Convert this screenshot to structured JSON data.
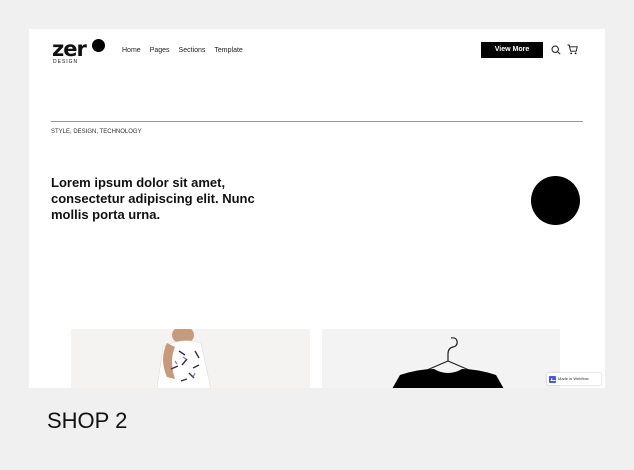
{
  "preview": {
    "brand": {
      "word": "zer",
      "subtitle": "DESIGN"
    },
    "nav": {
      "links": [
        "Home",
        "Pages",
        "Sections",
        "Template"
      ]
    },
    "cta_label": "View More",
    "icons": {
      "search": "search-icon",
      "cart": "cart-icon"
    },
    "tagline": "STYLE, DESIGN, TECHNOLOGY",
    "hero_text": "Lorem ipsum dolor sit amet, consectetur adipiscing elit. Nunc mollis porta urna.",
    "badge_label": "Made in Webflow",
    "colors": {
      "accent": "#000000",
      "background": "#ffffff",
      "page": "#f0f0f0",
      "webflow": "#4353ff"
    }
  },
  "caption": "SHOP 2"
}
